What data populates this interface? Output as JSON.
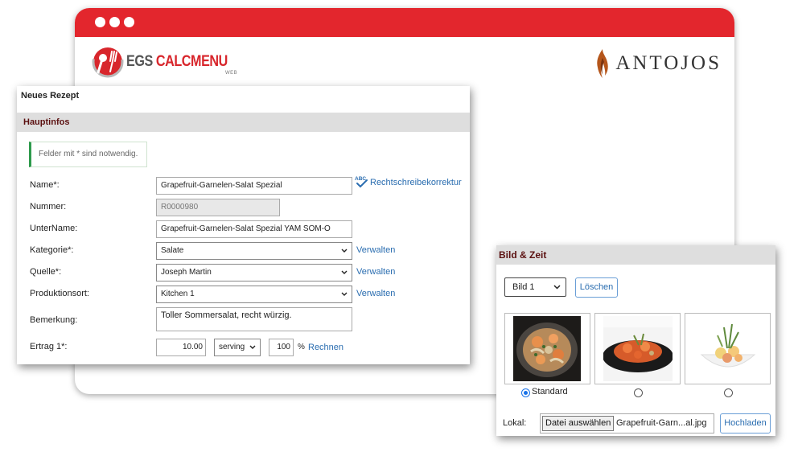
{
  "brand": {
    "logo_left_prefix": "EGS ",
    "logo_left_main": "CALCMENU",
    "logo_left_sub": "WEB",
    "logo_right": "ANTOJOS"
  },
  "recipe_form": {
    "title": "Neues Rezept",
    "section": "Hauptinfos",
    "notice": "Felder mit * sind notwendig.",
    "spellcheck_label": "Rechtschreibekorrektur",
    "fields": {
      "name": {
        "label": "Name*:",
        "value": "Grapefruit-Garnelen-Salat Spezial"
      },
      "nummer": {
        "label": "Nummer:",
        "value": "R0000980"
      },
      "untername": {
        "label": "UnterName:",
        "value": "Grapefruit-Garnelen-Salat Spezial YAM SOM-O"
      },
      "kategorie": {
        "label": "Kategorie*:",
        "value": "Salate",
        "action": "Verwalten"
      },
      "quelle": {
        "label": "Quelle*:",
        "value": "Joseph Martin",
        "action": "Verwalten"
      },
      "produktionsort": {
        "label": "Produktionsort:",
        "value": "Kitchen 1",
        "action": "Verwalten"
      },
      "bemerkung": {
        "label": "Bemerkung:",
        "value": "Toller Sommersalat, recht würzig."
      },
      "ertrag": {
        "label": "Ertrag 1*:",
        "quantity": "10.00",
        "unit": "serving",
        "percent": "100",
        "percent_symbol": "%",
        "action": "Rechnen"
      }
    }
  },
  "image_panel": {
    "title": "Bild & Zeit",
    "image_select": "Bild 1",
    "delete_button": "Löschen",
    "images": [
      {
        "icon": "shrimp-pasta-photo",
        "selected": true,
        "label": "Standard"
      },
      {
        "icon": "shrimp-plate-photo",
        "selected": false,
        "label": ""
      },
      {
        "icon": "salad-bowl-photo",
        "selected": false,
        "label": ""
      }
    ],
    "local_label": "Lokal:",
    "file_button": "Datei auswählen",
    "file_name": "Grapefruit-Garn...al.jpg",
    "upload_button": "Hochladen"
  },
  "colors": {
    "brand_red": "#e3262d",
    "section_title": "#5b1010",
    "link_blue": "#2a6db0",
    "notice_green": "#2e9a4c"
  }
}
